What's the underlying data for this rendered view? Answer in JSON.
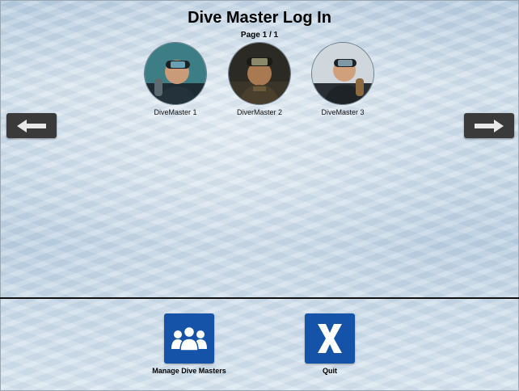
{
  "header": {
    "title": "Dive Master Log In",
    "page_indicator": "Page 1 / 1"
  },
  "profiles": [
    {
      "name": "DiveMaster 1"
    },
    {
      "name": "DiverMaster 2"
    },
    {
      "name": "DiveMaster 3"
    }
  ],
  "nav": {
    "prev_icon": "arrow-left-icon",
    "next_icon": "arrow-right-icon"
  },
  "actions": {
    "manage_label": "Manage Dive Masters",
    "manage_icon": "group-icon",
    "quit_label": "Quit",
    "quit_icon": "x-icon"
  },
  "colors": {
    "button_blue": "#1553a8",
    "arrow_button": "#3a3a3a"
  }
}
